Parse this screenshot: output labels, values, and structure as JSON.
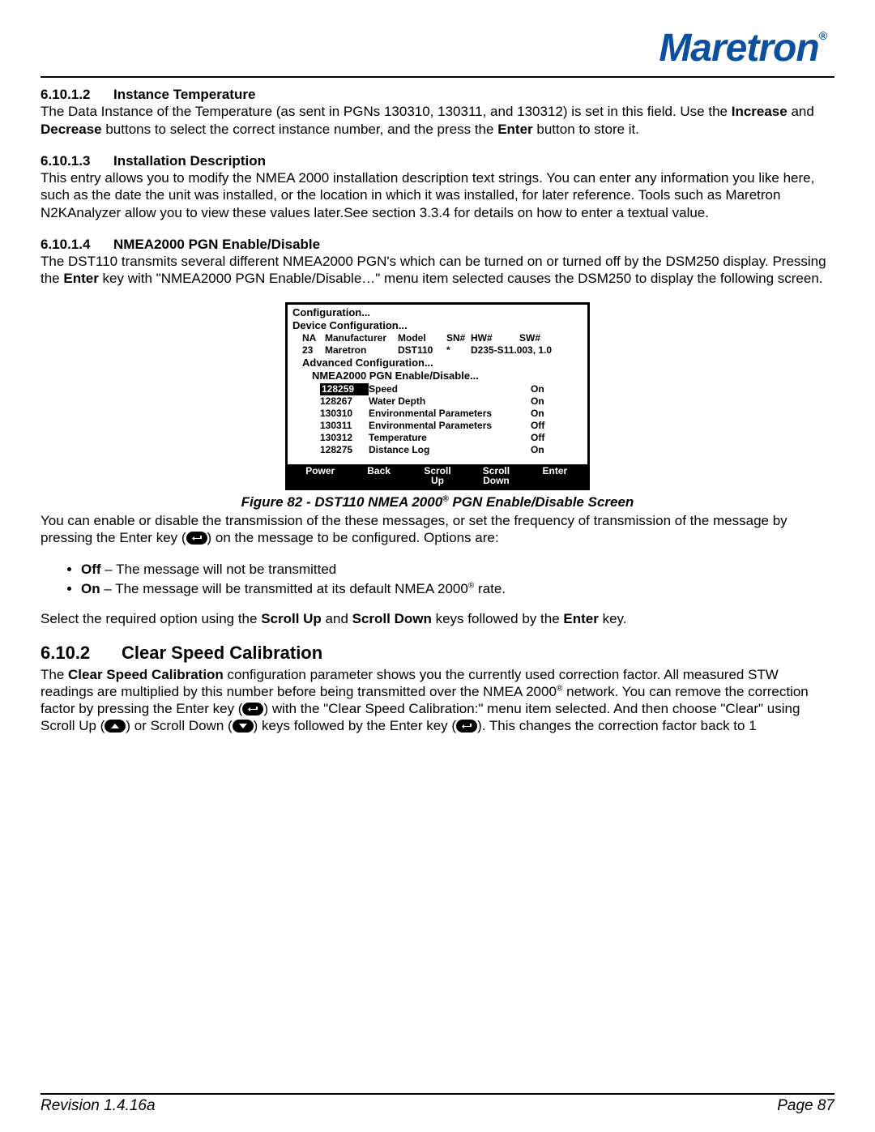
{
  "brand": "Maretron",
  "sections": {
    "s61012": {
      "num": "6.10.1.2",
      "title": "Instance Temperature",
      "body_pre": "The Data Instance of the Temperature (as sent in PGNs 130310, 130311, and 130312) is set in this field. Use the ",
      "b1": "Increase",
      "mid": " and ",
      "b2": "Decrease",
      "body_post": " buttons to select the correct instance number, and the press the ",
      "b3": "Enter",
      "body_end": " button to store it."
    },
    "s61013": {
      "num": "6.10.1.3",
      "title": "Installation Description",
      "body": "This entry allows you to modify the NMEA 2000 installation description text strings.  You can enter any information you like here, such as the date the unit was installed, or the location in which it was installed, for later reference.  Tools such as Maretron N2KAnalyzer allow you to view these values later.See section 3.3.4 for details on how to enter a textual value."
    },
    "s61014": {
      "num": "6.10.1.4",
      "title": "NMEA2000 PGN Enable/Disable",
      "body_pre": "The DST110 transmits several different NMEA2000 PGN's which can be turned on or turned off by the DSM250 display. Pressing the ",
      "b1": "Enter",
      "body_post": " key with \"NMEA2000 PGN Enable/Disable…\" menu item selected causes the DSM250 to display the following screen."
    },
    "s6102": {
      "num": "6.10.2",
      "title": "Clear Speed Calibration",
      "p_pre": "The ",
      "p_b1": "Clear Speed Calibration",
      "p_mid1": " configuration parameter shows you the currently used correction factor. All measured STW readings are multiplied by this number before being transmitted over the NMEA 2000",
      "p_mid2": " network. You can remove the correction factor by pressing the Enter key (",
      "p_mid3": ") with the \"Clear Speed Calibration:\" menu item selected. And then choose \"Clear\" using Scroll Up (",
      "p_mid4": ") or Scroll Down (",
      "p_mid5": ") keys followed by the Enter key (",
      "p_end": "). This changes the correction factor back to 1"
    }
  },
  "screen": {
    "l1": "Configuration...",
    "l2": "Device Configuration...",
    "cols": {
      "na": "NA",
      "mfr": "Manufacturer",
      "model": "Model",
      "sn": "SN#",
      "hw": "HW#",
      "sw": "SW#"
    },
    "vals": {
      "na": "23",
      "mfr": "Maretron",
      "model": "DST110",
      "sn": "*",
      "hwsw": "D235-S11.003, 1.0"
    },
    "l3": "Advanced Configuration...",
    "l4": "NMEA2000 PGN Enable/Disable...",
    "rows": [
      {
        "pgn": "128259",
        "name": "Speed",
        "state": "On",
        "sel": true
      },
      {
        "pgn": "128267",
        "name": "Water Depth",
        "state": "On"
      },
      {
        "pgn": "130310",
        "name": "Environmental Parameters",
        "state": "On"
      },
      {
        "pgn": "130311",
        "name": "Environmental Parameters",
        "state": "Off"
      },
      {
        "pgn": "130312",
        "name": "Temperature",
        "state": "Off"
      },
      {
        "pgn": "128275",
        "name": "Distance Log",
        "state": "On"
      }
    ],
    "buttons": {
      "power": "Power",
      "back": "Back",
      "up": "Scroll\nUp",
      "down": "Scroll\nDown",
      "enter": "Enter"
    }
  },
  "fig_caption_pre": "Figure 82 - DST110 NMEA 2000",
  "fig_caption_post": " PGN Enable/Disable Screen",
  "after_fig": {
    "p1_pre": "You can enable or disable the transmission of the these messages, or set the frequency of transmission of the message by pressing the Enter key (",
    "p1_post": ") on the message to be configured. Options are:",
    "off_b": "Off",
    "off_t": " – The message will not be transmitted",
    "on_b": "On",
    "on_t_pre": " – The message will be transmitted at its default NMEA 2000",
    "on_t_post": " rate.",
    "p2_pre": "Select the required option using the ",
    "p2_b1": "Scroll Up",
    "p2_mid": " and ",
    "p2_b2": "Scroll Down",
    "p2_mid2": " keys followed by the ",
    "p2_b3": "Enter",
    "p2_end": " key."
  },
  "footer": {
    "rev": "Revision 1.4.16a",
    "page": "Page 87"
  }
}
